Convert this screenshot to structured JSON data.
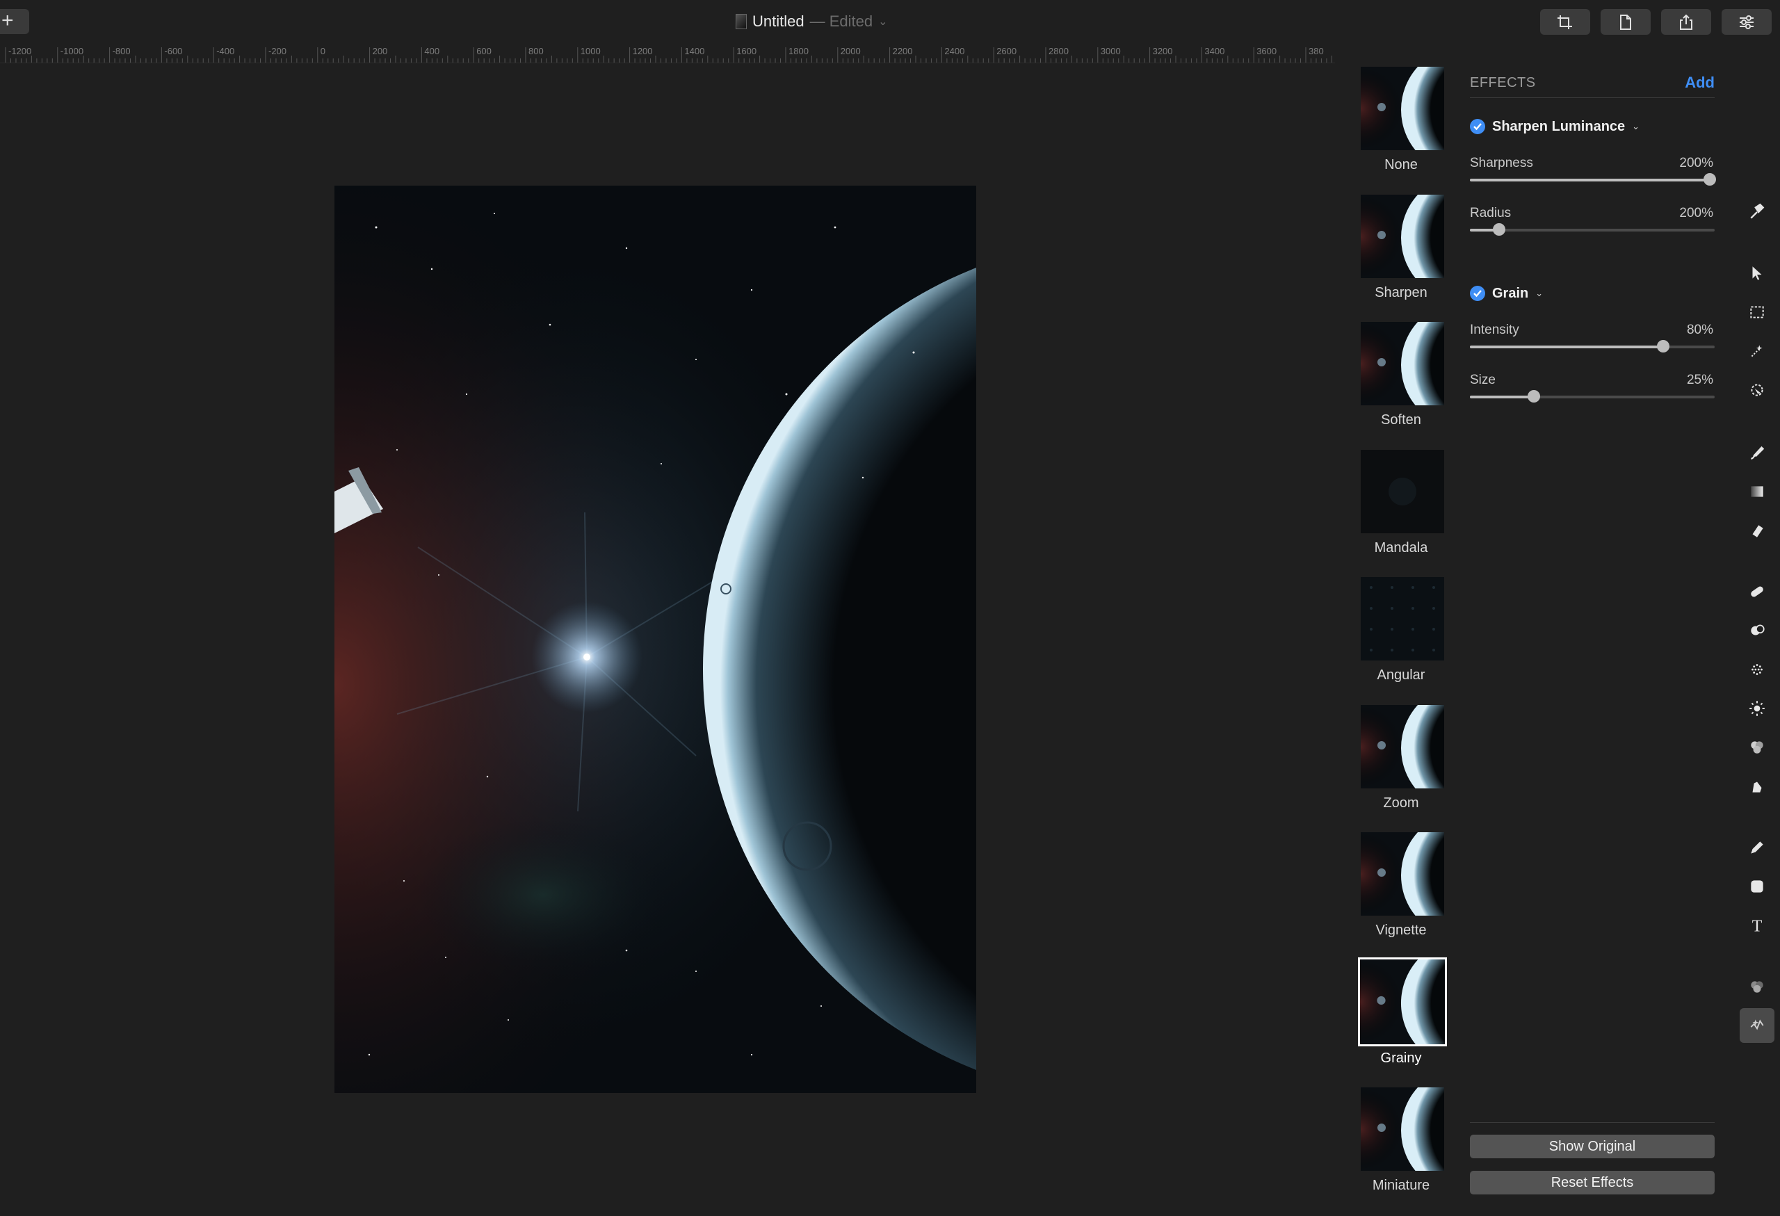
{
  "titlebar": {
    "plus_label": "+",
    "document_name": "Untitled",
    "edited_label": "— Edited",
    "chevron": "⌄",
    "buttons": [
      {
        "name": "crop-icon"
      },
      {
        "name": "document-icon"
      },
      {
        "name": "share-icon"
      },
      {
        "name": "sliders-icon"
      }
    ]
  },
  "ruler": {
    "labels": [
      "-1200",
      "-1000",
      "-800",
      "-600",
      "-400",
      "-200",
      "0",
      "200",
      "400",
      "600",
      "800",
      "1000",
      "1200",
      "1400",
      "1600",
      "1800",
      "2000",
      "2200",
      "2400",
      "2600",
      "2800",
      "3000",
      "3200",
      "3400",
      "3600",
      "380"
    ]
  },
  "presets": [
    {
      "label": "None"
    },
    {
      "label": "Sharpen"
    },
    {
      "label": "Soften"
    },
    {
      "label": "Mandala"
    },
    {
      "label": "Angular"
    },
    {
      "label": "Zoom"
    },
    {
      "label": "Vignette"
    },
    {
      "label": "Grainy",
      "selected": true
    },
    {
      "label": "Miniature"
    }
  ],
  "panel": {
    "header": "EFFECTS",
    "add_label": "Add",
    "effects": [
      {
        "title": "Sharpen Luminance",
        "enabled": true,
        "params": [
          {
            "label": "Sharpness",
            "value": "200%",
            "level": 0.98
          },
          {
            "label": "Radius",
            "value": "200%",
            "level": 0.12
          }
        ]
      },
      {
        "title": "Grain",
        "enabled": true,
        "params": [
          {
            "label": "Intensity",
            "value": "80%",
            "level": 0.79
          },
          {
            "label": "Size",
            "value": "25%",
            "level": 0.26
          }
        ]
      }
    ],
    "show_original_label": "Show Original",
    "reset_effects_label": "Reset Effects"
  },
  "colors": {
    "accent": "#3f8ef5",
    "background": "#1f1f1f",
    "button": "#545454"
  },
  "tools": [
    "hammer-icon",
    "arrow-select-icon",
    "rect-select-icon",
    "magic-select-icon",
    "color-select-icon",
    "paint-brush-icon",
    "gradient-icon",
    "eraser-icon",
    "bandage-icon",
    "clone-stamp-icon",
    "blur-icon",
    "light-icon",
    "color-adjust-icon",
    "smudge-icon",
    "pen-icon",
    "shape-icon",
    "text-icon",
    "color-blend-icon",
    "effects-icon"
  ]
}
